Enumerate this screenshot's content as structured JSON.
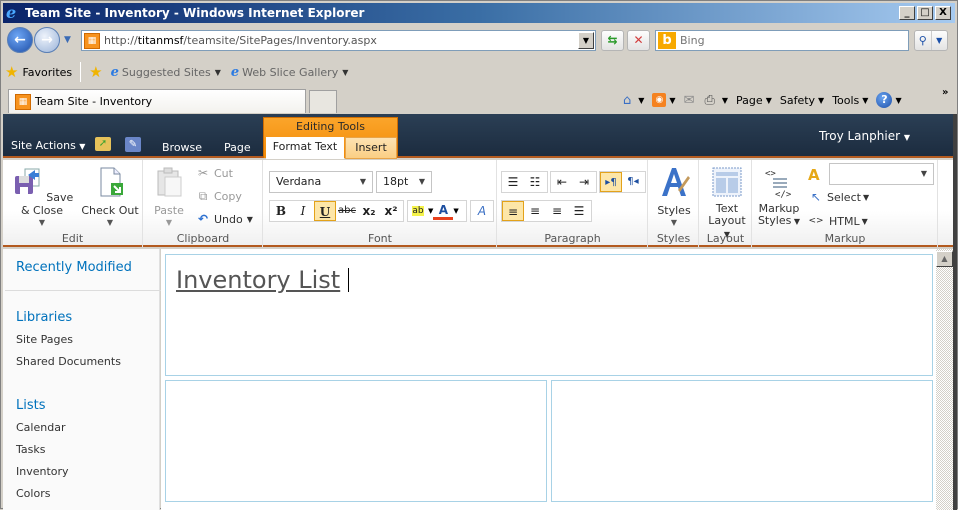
{
  "window": {
    "title": "Team Site - Inventory - Windows Internet Explorer",
    "minimize": "_",
    "maximize": "□",
    "close": "X"
  },
  "address_bar": {
    "url_prefix": "http://",
    "url_host": "titanmsf",
    "url_path": "/teamsite/SitePages/Inventory.aspx"
  },
  "search": {
    "placeholder": "Bing",
    "provider_icon": "b"
  },
  "favorites_bar": {
    "favorites_label": "Favorites",
    "items": [
      {
        "label": "Suggested Sites",
        "icon": "ie-icon"
      },
      {
        "label": "Web Slice Gallery",
        "icon": "ie-page-icon"
      }
    ]
  },
  "tab": {
    "label": "Team Site - Inventory"
  },
  "command_bar": {
    "page": "Page",
    "safety": "Safety",
    "tools": "Tools",
    "help_icon": "?",
    "overflow": "»"
  },
  "sharepoint": {
    "site_actions": "Site Actions",
    "tabs": {
      "browse": "Browse",
      "page": "Page",
      "context_group": "Editing Tools",
      "format_text": "Format Text",
      "insert": "Insert"
    },
    "user": "Troy Lanphier"
  },
  "ribbon": {
    "edit": {
      "label": "Edit",
      "save_close": "Save & Close",
      "check_out": "Check Out"
    },
    "clipboard": {
      "label": "Clipboard",
      "paste": "Paste",
      "cut": "Cut",
      "copy": "Copy",
      "undo": "Undo"
    },
    "font": {
      "label": "Font",
      "font_family": "Verdana",
      "font_size": "18pt",
      "bold": "B",
      "italic": "I",
      "underline": "U",
      "strikethrough": "abc",
      "subscript": "x₂",
      "superscript": "x²",
      "underline_active": true,
      "font_color": "#e8401c"
    },
    "paragraph": {
      "label": "Paragraph",
      "ltr_active": true,
      "align_left_active": true
    },
    "styles": {
      "label": "Styles",
      "button": "Styles"
    },
    "layout": {
      "label": "Layout",
      "button_line1": "Text",
      "button_line2": "Layout"
    },
    "markup": {
      "label": "Markup",
      "markup_styles_line1": "Markup",
      "markup_styles_line2": "Styles",
      "select": "Select",
      "html": "HTML",
      "language_value": ""
    }
  },
  "left_nav": {
    "recently_modified": "Recently Modified",
    "libraries": {
      "heading": "Libraries",
      "items": [
        "Site Pages",
        "Shared Documents"
      ]
    },
    "lists": {
      "heading": "Lists",
      "items": [
        "Calendar",
        "Tasks",
        "Inventory",
        "Colors"
      ]
    }
  },
  "content": {
    "page_heading": "Inventory List"
  },
  "colors": {
    "ribbon_accent": "#b35a1f",
    "context_tab": "#f28a07",
    "link_blue": "#0072bc",
    "zone_border": "#a8d2e6"
  }
}
